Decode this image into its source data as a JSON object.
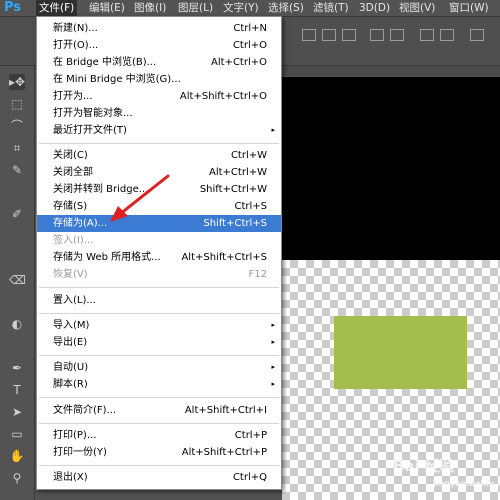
{
  "app": {
    "logo": "Ps"
  },
  "menubar": [
    {
      "label": "文件(F)",
      "active": true
    },
    {
      "label": "编辑(E)"
    },
    {
      "label": "图像(I)"
    },
    {
      "label": "图层(L)"
    },
    {
      "label": "文字(Y)"
    },
    {
      "label": "选择(S)"
    },
    {
      "label": "滤镜(T)"
    },
    {
      "label": "3D(D)"
    },
    {
      "label": "视图(V)"
    },
    {
      "label": "窗口(W)"
    }
  ],
  "file_menu": [
    {
      "label": "新建(N)...",
      "shortcut": "Ctrl+N"
    },
    {
      "label": "打开(O)...",
      "shortcut": "Ctrl+O"
    },
    {
      "label": "在 Bridge 中浏览(B)...",
      "shortcut": "Alt+Ctrl+O"
    },
    {
      "label": "在 Mini Bridge 中浏览(G)...",
      "shortcut": ""
    },
    {
      "label": "打开为...",
      "shortcut": "Alt+Shift+Ctrl+O"
    },
    {
      "label": "打开为智能对象...",
      "shortcut": ""
    },
    {
      "label": "最近打开文件(T)",
      "shortcut": "",
      "submenu": true
    },
    {
      "label": "关闭(C)",
      "shortcut": "Ctrl+W"
    },
    {
      "label": "关闭全部",
      "shortcut": "Alt+Ctrl+W"
    },
    {
      "label": "关闭并转到 Bridge...",
      "shortcut": "Shift+Ctrl+W"
    },
    {
      "label": "存储(S)",
      "shortcut": "Ctrl+S"
    },
    {
      "label": "存储为(A)...",
      "shortcut": "Shift+Ctrl+S",
      "highlighted": true
    },
    {
      "label": "签入(I)...",
      "shortcut": "",
      "disabled": true
    },
    {
      "label": "存储为 Web 所用格式...",
      "shortcut": "Alt+Shift+Ctrl+S"
    },
    {
      "label": "恢复(V)",
      "shortcut": "F12",
      "disabled": true
    },
    {
      "label": "置入(L)...",
      "shortcut": ""
    },
    {
      "label": "导入(M)",
      "shortcut": "",
      "submenu": true
    },
    {
      "label": "导出(E)",
      "shortcut": "",
      "submenu": true
    },
    {
      "label": "自动(U)",
      "shortcut": "",
      "submenu": true
    },
    {
      "label": "脚本(R)",
      "shortcut": "",
      "submenu": true
    },
    {
      "label": "文件简介(F)...",
      "shortcut": "Alt+Shift+Ctrl+I"
    },
    {
      "label": "打印(P)...",
      "shortcut": "Ctrl+P"
    },
    {
      "label": "打印一份(Y)",
      "shortcut": "Alt+Shift+Ctrl+P"
    },
    {
      "label": "退出(X)",
      "shortcut": "Ctrl+Q"
    }
  ],
  "submenu_glyph": "▸",
  "tools": [
    "▸✥",
    "⬚",
    "⌒",
    "⌗",
    "✎",
    "✐",
    "⌫",
    "◐",
    "✒",
    "T",
    "➤",
    "▭",
    "✋",
    "⚲"
  ],
  "colors": {
    "accent": "#3b7bd4",
    "shape_fill": "#a3bd4f",
    "arrow": "#e02020"
  },
  "watermark": {
    "text": "Bai 经验",
    "sub": "jingyan.baidu.com"
  }
}
